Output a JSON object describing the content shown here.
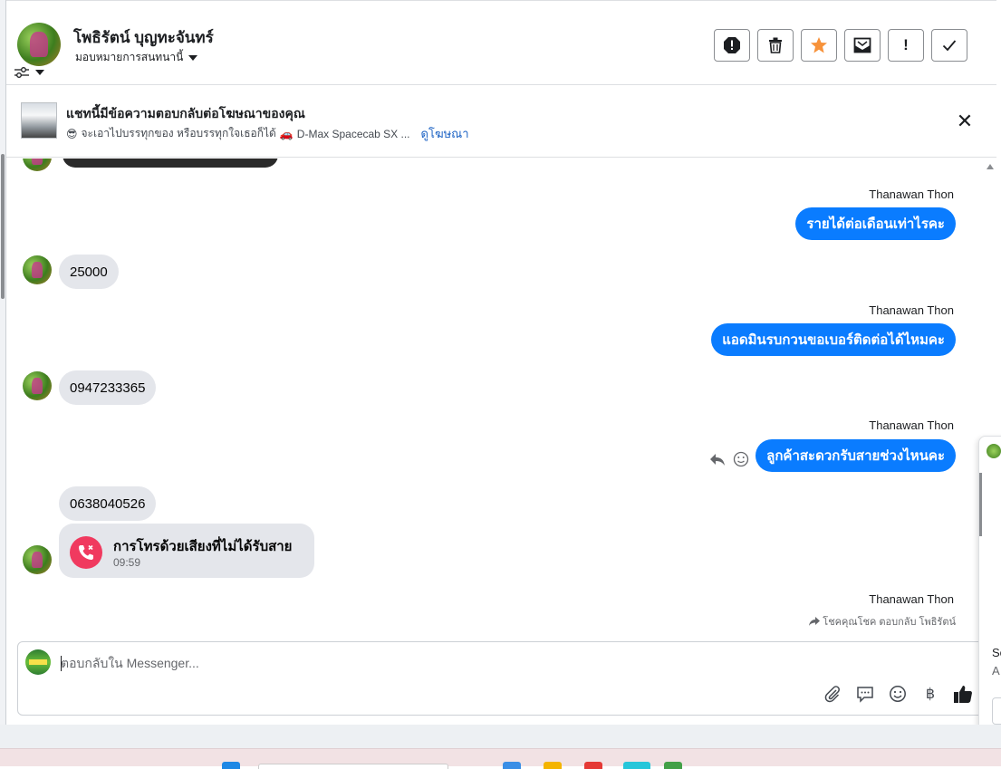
{
  "header": {
    "contact_name": "โพธิรัตน์ บุญทะจันทร์",
    "assign_label": "มอบหมายการสนทนานี้",
    "actions": [
      {
        "name": "spam-report",
        "glyph": "!"
      },
      {
        "name": "delete",
        "glyph": "🗑"
      },
      {
        "name": "star",
        "glyph": "★"
      },
      {
        "name": "mark-unread",
        "glyph": "✉"
      },
      {
        "name": "follow-up",
        "glyph": "!"
      },
      {
        "name": "mark-done",
        "glyph": "✓"
      }
    ]
  },
  "ad_banner": {
    "title": "แชทนี้มีข้อความตอบกลับต่อโฆษณาของคุณ",
    "emoji_lead": "😎",
    "subtitle": "จะเอาไปบรรทุกของ หรือบรรทุกใจเธอก็ได้",
    "emoji_car": "🚗",
    "ad_name": "D-Max Spacecab SX ...",
    "view_ad_link": "ดูโฆษณา",
    "close_glyph": "✕"
  },
  "thread": {
    "messages": [
      {
        "side": "out",
        "sender": "Thanawan Thon",
        "text": "รายได้ต่อเดือนเท่าไรคะ"
      },
      {
        "side": "in",
        "text": "25000"
      },
      {
        "side": "out",
        "sender": "Thanawan Thon",
        "text": "แอดมินรบกวนขอเบอร์ติดต่อได้ไหมคะ"
      },
      {
        "side": "in",
        "text": "0947233365"
      },
      {
        "side": "out",
        "sender": "Thanawan Thon",
        "text": "ลูกค้าสะดวกรับสายช่วงไหนคะ"
      },
      {
        "side": "in",
        "text": "0638040526"
      }
    ],
    "missed_call": {
      "title": "การโทรด้วยเสียงที่ไม่ได้รับสาย",
      "time": "09:59"
    },
    "last_sender": "Thanawan Thon",
    "reply_note": "โชคคุณโชค ตอบกลับ โพธิรัตน์"
  },
  "composer": {
    "placeholder": "ตอบกลับใน Messenger...",
    "tools": [
      "paperclip-icon",
      "saved-reply-icon",
      "emoji-icon",
      "baht-icon",
      "thumbs-up-icon"
    ],
    "baht_glyph": "฿"
  },
  "side_peek": {
    "line1": "Sc",
    "line2": "A"
  },
  "colors": {
    "accent": "#0a7cff",
    "incoming": "#e4e6eb",
    "missed_call": "#f03a5f",
    "link": "#1d63c4"
  }
}
